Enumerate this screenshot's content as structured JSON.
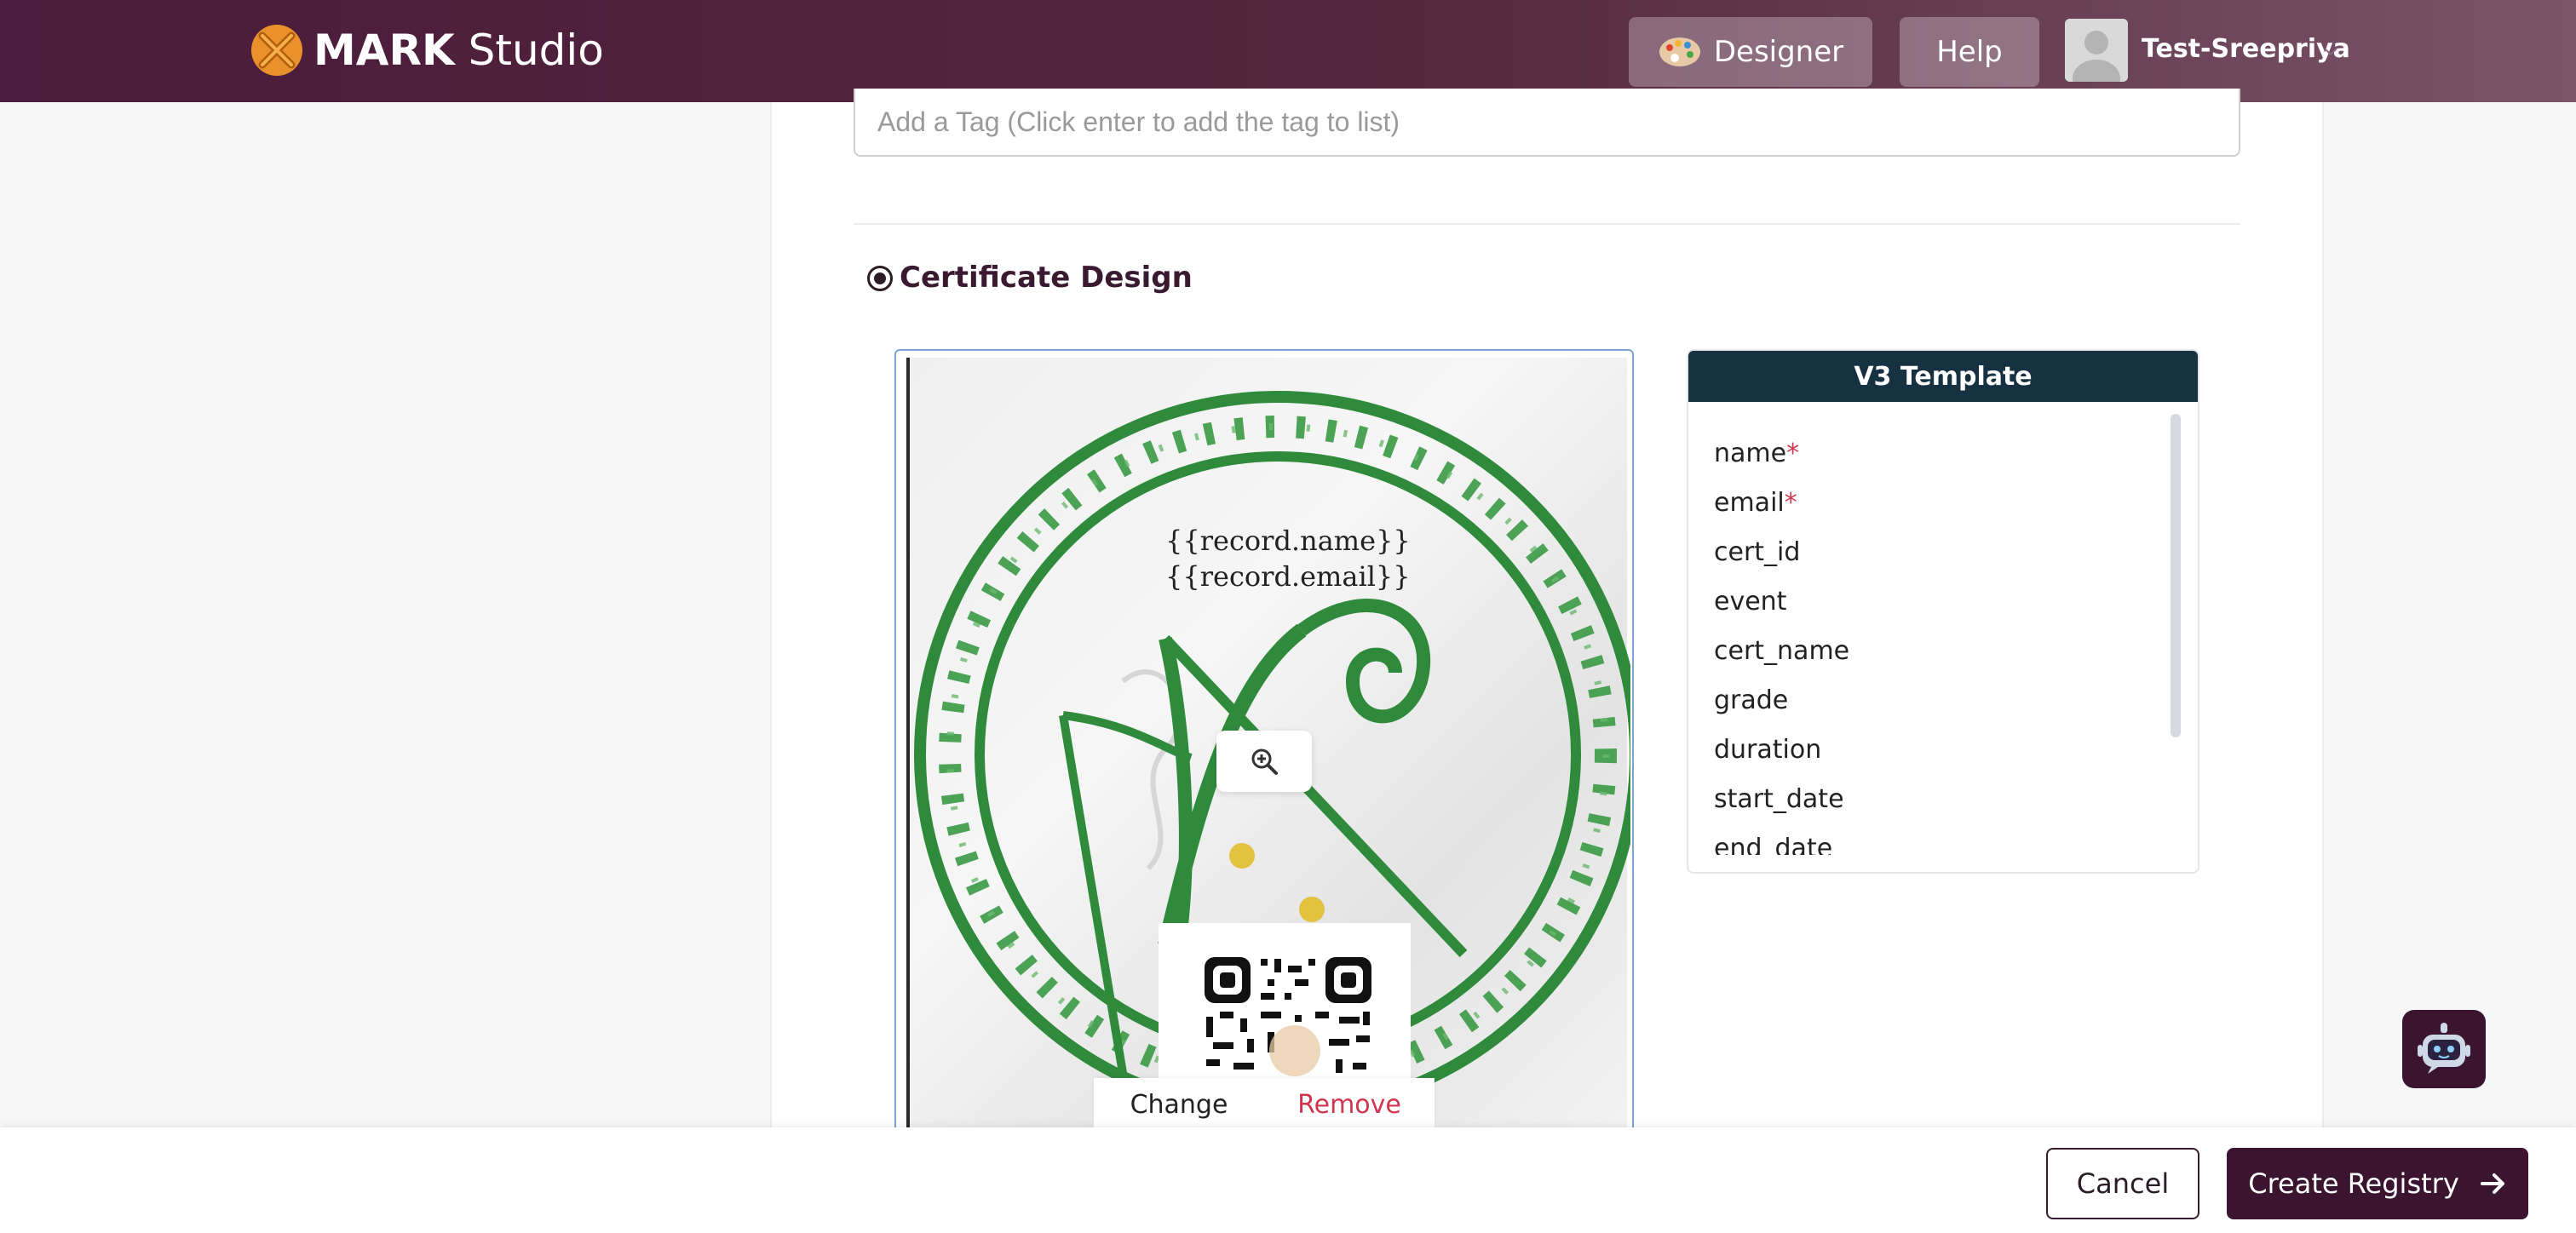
{
  "header": {
    "brand_bold": "MARK",
    "brand_light": "Studio",
    "designer_label": "Designer",
    "help_label": "Help",
    "username": "Test-Sreepriya"
  },
  "form": {
    "tag_placeholder": "Add a Tag (Click enter to add the tag to list)",
    "section_title": "Certificate Design"
  },
  "certificate": {
    "line1": "{{record.name}}",
    "line2": "{{record.email}}",
    "change_label": "Change",
    "remove_label": "Remove"
  },
  "template": {
    "title": "V3 Template",
    "fields": [
      {
        "label": "name",
        "required": "*"
      },
      {
        "label": "email",
        "required": "*"
      },
      {
        "label": "cert_id",
        "required": ""
      },
      {
        "label": "event",
        "required": ""
      },
      {
        "label": "cert_name",
        "required": ""
      },
      {
        "label": "grade",
        "required": ""
      },
      {
        "label": "duration",
        "required": ""
      },
      {
        "label": "start_date",
        "required": ""
      },
      {
        "label": "end_date",
        "required": ""
      }
    ]
  },
  "footer": {
    "cancel_label": "Cancel",
    "create_label": "Create Registry"
  },
  "colors": {
    "header_start": "#4b1c3b",
    "primary": "#3b1530",
    "template_header": "#163142",
    "danger": "#d0364f",
    "logo_orange": "#e9912a"
  },
  "icons": {
    "designer": "palette-icon",
    "zoom": "zoom-in-icon",
    "create": "arrow-right-icon",
    "bot": "robot-icon"
  }
}
